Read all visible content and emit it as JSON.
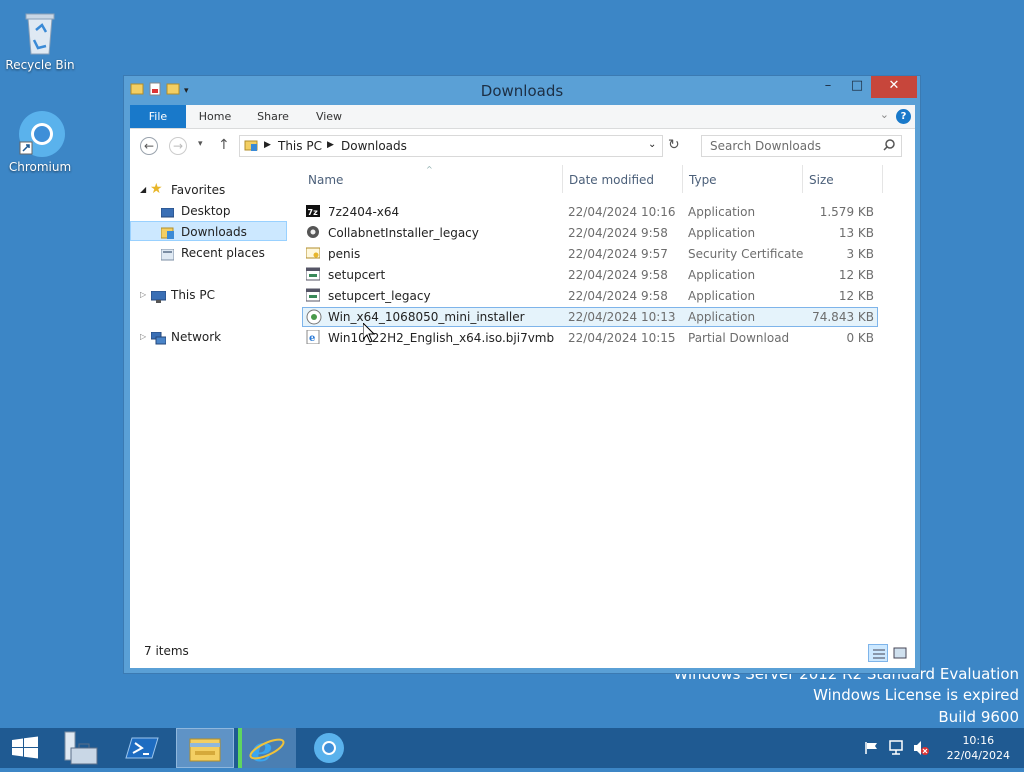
{
  "desktop": {
    "icons": [
      {
        "label": "Recycle Bin",
        "icon": "recycle-bin-icon"
      },
      {
        "label": "Chromium",
        "icon": "chromium-icon"
      }
    ],
    "watermark": [
      "Windows Server 2012 R2 Standard Evaluation",
      "Windows License is expired",
      "Build 9600"
    ]
  },
  "window": {
    "title": "Downloads",
    "controls": {
      "minimize": "–",
      "maximize": "□",
      "close": "✕"
    },
    "ribbon": {
      "tabs": [
        "File",
        "Home",
        "Share",
        "View"
      ],
      "help": "?"
    },
    "address": {
      "segments": [
        "This PC",
        "Downloads"
      ]
    },
    "search": {
      "placeholder": "Search Downloads"
    },
    "nav": {
      "favorites": "Favorites",
      "items": [
        "Desktop",
        "Downloads",
        "Recent places"
      ],
      "selected": "Downloads",
      "this_pc": "This PC",
      "network": "Network"
    },
    "columns": [
      "Name",
      "Date modified",
      "Type",
      "Size"
    ],
    "files": [
      {
        "name": "7z2404-x64",
        "date": "22/04/2024 10:16",
        "type": "Application",
        "size": "1.579 KB",
        "icon": "7zip-icon"
      },
      {
        "name": "CollabnetInstaller_legacy",
        "date": "22/04/2024 9:58",
        "type": "Application",
        "size": "13 KB",
        "icon": "installer-icon"
      },
      {
        "name": "penis",
        "date": "22/04/2024 9:57",
        "type": "Security Certificate",
        "size": "3 KB",
        "icon": "certificate-icon"
      },
      {
        "name": "setupcert",
        "date": "22/04/2024 9:58",
        "type": "Application",
        "size": "12 KB",
        "icon": "app-window-icon"
      },
      {
        "name": "setupcert_legacy",
        "date": "22/04/2024 9:58",
        "type": "Application",
        "size": "12 KB",
        "icon": "app-window-icon"
      },
      {
        "name": "Win_x64_1068050_mini_installer",
        "date": "22/04/2024 10:13",
        "type": "Application",
        "size": "74.843 KB",
        "icon": "chromium-installer-icon"
      },
      {
        "name": "Win10_22H2_English_x64.iso.bji7vmb",
        "date": "22/04/2024 10:15",
        "type": "Partial Download",
        "size": "0 KB",
        "icon": "ie-file-icon"
      }
    ],
    "selected_row": 5,
    "status": "7 items"
  },
  "taskbar": {
    "time": "10:16",
    "date": "22/04/2024"
  }
}
